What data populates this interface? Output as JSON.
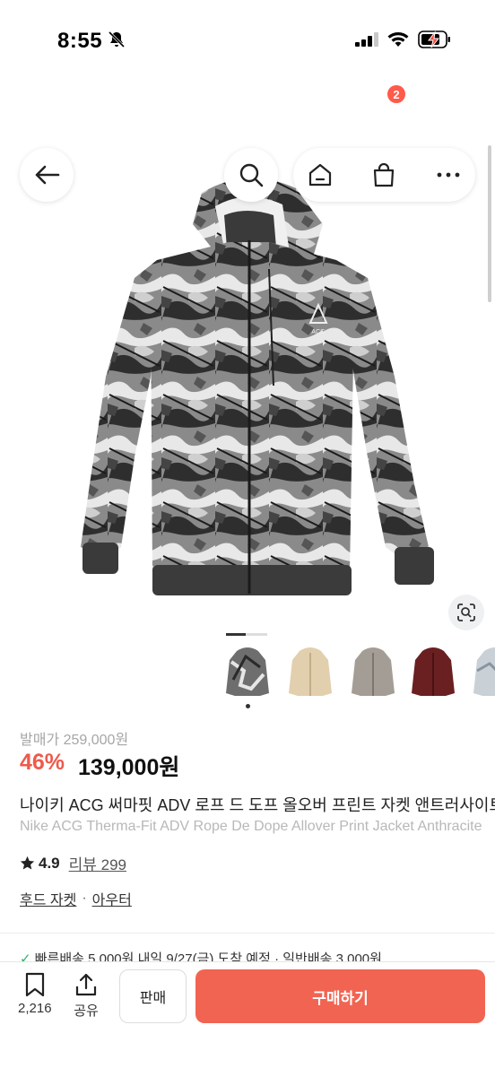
{
  "status_bar": {
    "time": "8:55"
  },
  "header": {
    "cart_count": "2"
  },
  "gallery": {
    "total_pages": 2,
    "current_page": 1
  },
  "thumbnails": [
    {
      "name": "print-jacket-thumb",
      "color": "#6e6e6e"
    },
    {
      "name": "beige-jacket-thumb",
      "color": "#e2cfad"
    },
    {
      "name": "grey-jacket-thumb",
      "color": "#a49d96"
    },
    {
      "name": "burgundy-jacket-thumb",
      "color": "#6a1f21"
    },
    {
      "name": "white-print-jacket-thumb",
      "color": "#c9d0d6"
    }
  ],
  "product": {
    "original_price": "발매가 259,000원",
    "discount": "46%",
    "price": "139,000원",
    "title_kr": "나이키 ACG 써마핏 ADV 로프 드 도프 올오버 프린트 자켓 앤트러사이트",
    "title_en": "Nike ACG Therma-Fit ADV Rope De Dope Allover Print Jacket Anthracite",
    "rating": "4.9",
    "reviews": "리뷰 299",
    "category_1": "후드 자켓",
    "category_sep": "·",
    "category_2": "아우터",
    "shipping": "빠른배송 5,000원 내일 9/27(금) 도착 예정   ·   일반배송 3,000원"
  },
  "bottom_bar": {
    "bookmark_count": "2,216",
    "share_label": "공유",
    "sell_label": "판매",
    "buy_label": "구매하기"
  },
  "colors": {
    "accent": "#f26452",
    "discount": "#ee5a4b",
    "badge": "#ff5a4a"
  }
}
